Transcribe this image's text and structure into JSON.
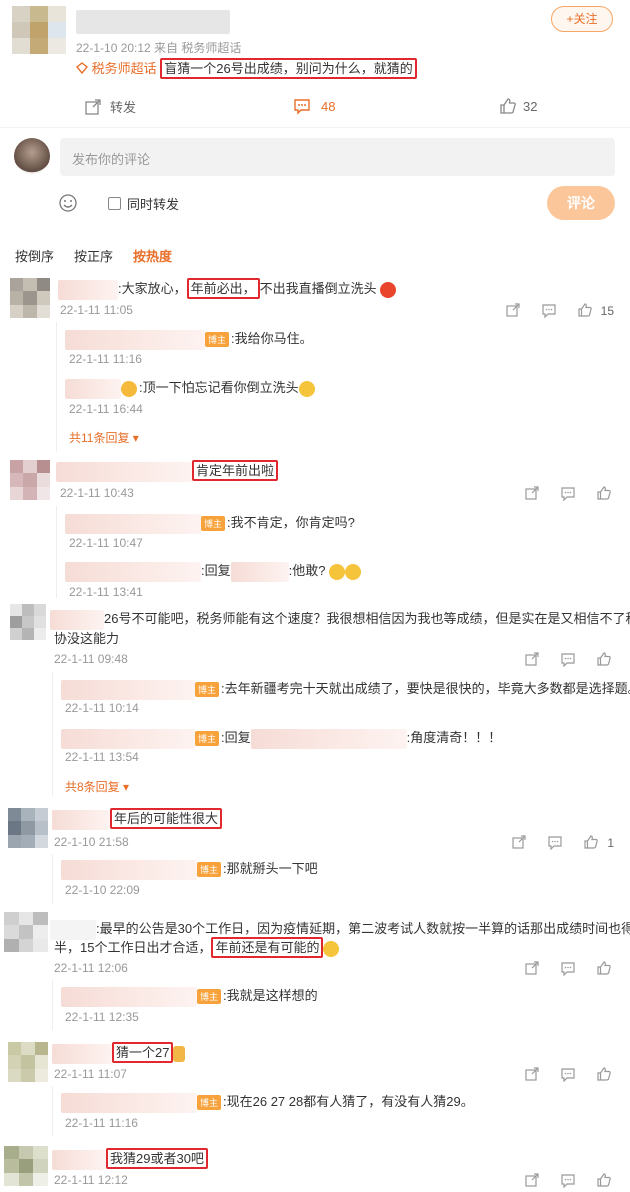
{
  "post": {
    "meta": "22-1-10 20:12 来自 税务师超话",
    "follow_label": "+关注",
    "topic_label": "税务师超话",
    "text": "盲猜一个26号出成绩，别问为什么，就猜的",
    "repost_label": "转发",
    "comment_count": "48",
    "like_count": "32"
  },
  "composer": {
    "placeholder": "发布你的评论",
    "repost_checkbox_label": "同时转发",
    "submit_label": "评论"
  },
  "sort_tabs": [
    "按倒序",
    "按正序",
    "按热度"
  ],
  "comments": [
    {
      "pre": ":大家放心，",
      "highlight": "年前必出，",
      "post": "不出我直播倒立洗头",
      "time": "22-1-11 11:05",
      "likes": "15",
      "replies": [
        {
          "badge": "博主",
          "text": ":我给你马住。",
          "time": "22-1-11 11:16"
        },
        {
          "badge": "",
          "text": ":顶一下怕忘记看你倒立洗头",
          "time": "22-1-11 16:44"
        }
      ],
      "more": "共11条回复"
    },
    {
      "pre": "",
      "highlight": "肯定年前出啦",
      "post": "",
      "time": "22-1-11 10:43",
      "likes": "",
      "replies": [
        {
          "badge": "博主",
          "text": ":我不肯定，你肯定吗?",
          "time": "22-1-11 10:47"
        },
        {
          "badge": "",
          "text": ":回复",
          "text2": ":他敢?",
          "time": "22-1-11 13:41"
        }
      ],
      "more": ""
    },
    {
      "pre": "26号不可能吧，税务师能有这个速度？我很想相信因为我也等成绩，但是实在是又相信不了税",
      "pre2": "协没这能力",
      "highlight": "",
      "post": "",
      "time": "22-1-11 09:48",
      "likes": "",
      "replies": [
        {
          "badge": "博主",
          "text": ":去年新疆考完十天就出成绩了，要快是很快的，毕竟大多数都是选择题。",
          "time": "22-1-11 10:14"
        },
        {
          "badge": "博主",
          "text": ":回复",
          "text2": ":角度清奇！！！",
          "time": "22-1-11 13:54"
        }
      ],
      "more": "共8条回复"
    },
    {
      "pre": "",
      "highlight": "年后的可能性很大",
      "post": "",
      "time": "22-1-10 21:58",
      "likes": "1",
      "replies": [
        {
          "badge": "博主",
          "text": ":那就掰头一下吧",
          "time": "22-1-10 22:09"
        }
      ],
      "more": ""
    },
    {
      "pre": ":最早的公告是30个工作日，因为疫情延期，第二波考试人数就按一半算的话那出成绩时间也得减",
      "pre2": "半，15个工作日出才合适，",
      "highlight": "年前还是有可能的",
      "post": "",
      "time": "22-1-11 12:06",
      "likes": "",
      "replies": [
        {
          "badge": "博主",
          "text": ":我就是这样想的",
          "time": "22-1-11 12:35"
        }
      ],
      "more": ""
    },
    {
      "pre": "",
      "highlight": "猜一个27",
      "post": "",
      "time": "22-1-11 11:07",
      "likes": "",
      "replies": [
        {
          "badge": "博主",
          "text": ":现在26 27 28都有人猜了，有没有人猜29。",
          "time": "22-1-11 11:16"
        }
      ],
      "more": ""
    },
    {
      "pre": "",
      "highlight": "我猜29或者30吧",
      "post": "",
      "time": "22-1-11 12:12",
      "likes": "",
      "replies": [],
      "more": ""
    }
  ]
}
